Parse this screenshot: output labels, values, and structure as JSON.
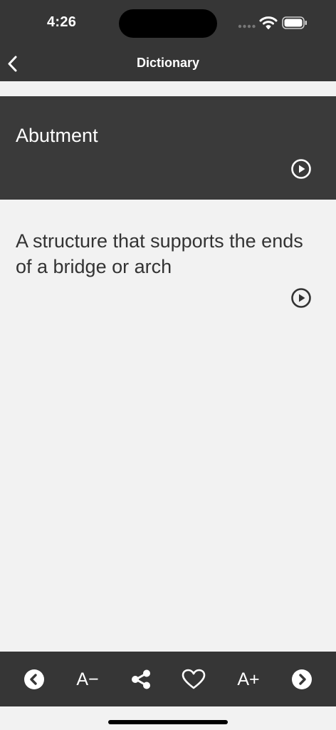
{
  "status_bar": {
    "time": "4:26"
  },
  "nav": {
    "title": "Dictionary"
  },
  "entry": {
    "term": "Abutment",
    "definition": "A structure that supports the ends of a bridge or arch"
  },
  "toolbar": {
    "decrease_font_label": "A−",
    "increase_font_label": "A+"
  },
  "colors": {
    "bar": "#363636",
    "term_panel": "#3a3a3a",
    "background": "#f2f2f2",
    "text_dark": "#333333"
  },
  "icons": [
    "chevron-left-icon",
    "play-circle-icon",
    "previous-circle-icon",
    "share-icon",
    "heart-icon",
    "next-circle-icon",
    "wifi-icon",
    "battery-icon",
    "signal-icon"
  ]
}
